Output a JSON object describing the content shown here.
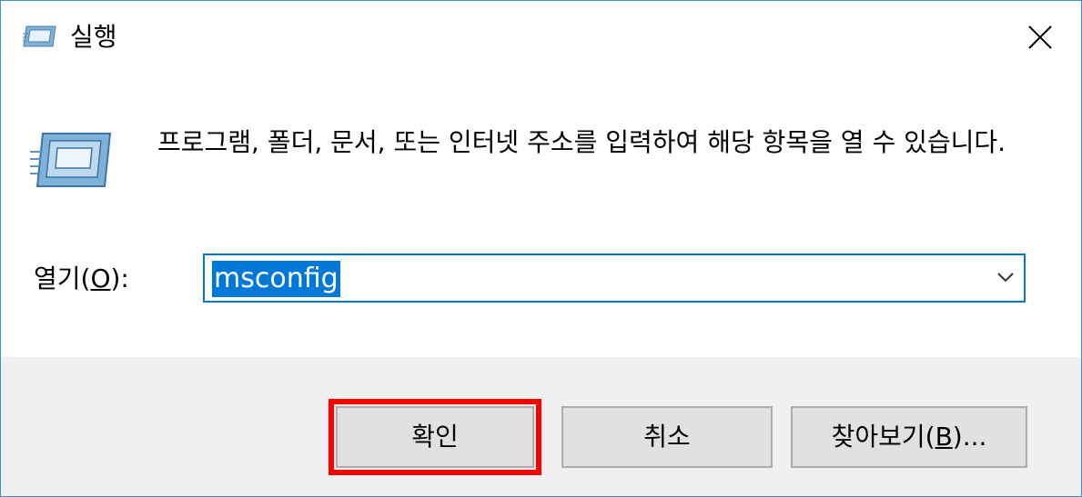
{
  "window": {
    "title": "실행"
  },
  "content": {
    "description": "프로그램, 폴더, 문서, 또는 인터넷 주소를 입력하여 해당 항목을 열 수 있습니다.",
    "open_label_prefix": "열기(",
    "open_label_mnemonic": "O",
    "open_label_suffix": "):",
    "open_value": "msconfig"
  },
  "buttons": {
    "ok_label": "확인",
    "cancel_label": "취소",
    "browse_prefix": "찾아보기(",
    "browse_mnemonic": "B",
    "browse_suffix": ")..."
  },
  "highlight": {
    "color": "#ff0000",
    "target": "확인"
  },
  "colors": {
    "accent": "#0078d7",
    "window_border": "#3c8fd6",
    "footer_bg": "#f0f0f0",
    "button_bg": "#e1e1e1"
  },
  "icons": {
    "title": "run-icon",
    "content": "run-icon",
    "close": "close-icon",
    "dropdown": "chevron-down-icon"
  }
}
